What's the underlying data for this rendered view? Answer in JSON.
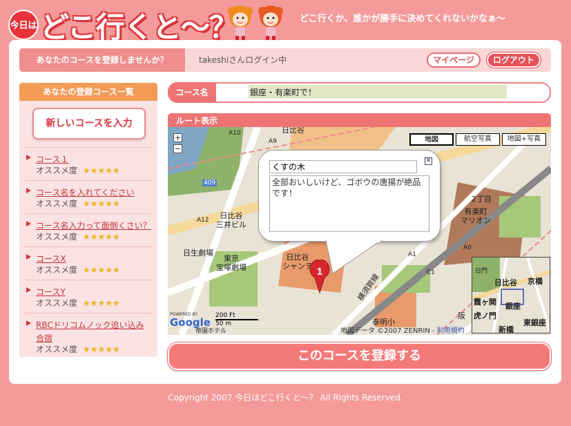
{
  "header": {
    "badge": "今日は",
    "logo": "どこ行くと〜？",
    "tagline": "どこ行くか、誰かが勝手に決めてくれないかなぁ〜"
  },
  "topbar": {
    "register_prompt": "あなたのコースを登録しませんか？",
    "login_status": "takeshiさんログイン中",
    "mypage_label": "マイページ",
    "logout_label": "ログアウト"
  },
  "sidebar": {
    "title": "あなたの登録コース一覧",
    "new_course_label": "新しいコースを入力",
    "rec_label": "オススメ度",
    "stars": "★★★★★",
    "courses": [
      {
        "name": "コース１"
      },
      {
        "name": "コース名を入れてください"
      },
      {
        "name": "コース名入力って面倒くさい？"
      },
      {
        "name": "コースX"
      },
      {
        "name": "コースY"
      },
      {
        "name": "RBCドリコムノック追い込み合宿"
      }
    ]
  },
  "course_form": {
    "label": "コース名",
    "value": "銀座・有楽町で！"
  },
  "route": {
    "title": "ルート表示",
    "map_tabs": [
      "地図",
      "航空写真",
      "地図+写真"
    ],
    "zoom_in": "+",
    "zoom_out": "−",
    "info_title": "くすの木",
    "info_body": "全部おいしいけど、ゴボウの唐揚が絶品です！",
    "close": "✕",
    "pin_number": "1",
    "labels": {
      "hibiya": "日比谷",
      "a10": "A10",
      "a9": "A9",
      "a12": "A12",
      "road409": "409",
      "hibiya_sanshin": "日比谷\n三井ビル",
      "nissei": "日生劇場",
      "tokyo_takarazuka": "東京\n宝塚劇場",
      "hibiya_chanter": "日比谷\nシャンテ",
      "nichome": "2丁目",
      "yurakucho_marion": "有楽町\nマリオン",
      "yurakucho": "有楽町",
      "a0": "A0",
      "a1": "A1",
      "c1": "C1",
      "kosoku": "横須賀線",
      "taimei": "泰明小",
      "teikoku": "帝国ホテル",
      "han": "阪"
    },
    "minimap_labels": [
      "日門",
      "日比谷",
      "京橋",
      "霞ヶ関",
      "銀座",
      "虎ノ門",
      "東銀座",
      "新橋"
    ],
    "scale_ft": "200 Ft",
    "scale_m": "50 m",
    "copyright": "地図データ ©2007 ZENRIN - ",
    "terms": "利用規約",
    "powered_by": "POWERED BY",
    "google": "Google"
  },
  "register_button": "このコースを登録する",
  "footer": "Copyright 2007 今日はどこ行くと〜？ All Rights Reserved."
}
